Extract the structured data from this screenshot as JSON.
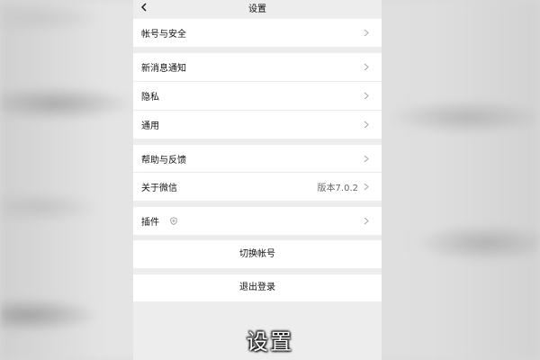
{
  "header": {
    "title": "设置",
    "back_icon": "chevron-left-icon"
  },
  "sections": {
    "account": {
      "label": "帐号与安全"
    },
    "notifications": {
      "label": "新消息通知"
    },
    "privacy": {
      "label": "隐私"
    },
    "general": {
      "label": "通用"
    },
    "help": {
      "label": "帮助与反馈"
    },
    "about": {
      "label": "关于微信",
      "value": "版本7.0.2"
    },
    "plugins": {
      "label": "插件",
      "icon": "shield-icon"
    }
  },
  "actions": {
    "switch_account": "切换帐号",
    "logout": "退出登录"
  },
  "caption": "设置",
  "colors": {
    "background": "#ededed",
    "cell": "#ffffff",
    "text": "#111111",
    "secondary": "#666666"
  }
}
